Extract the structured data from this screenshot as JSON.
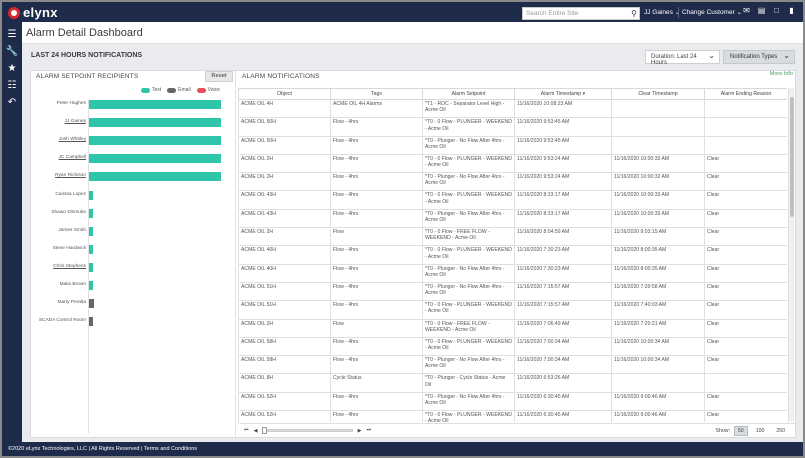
{
  "app": {
    "brand": "elynx",
    "search_placeholder": "Search Entire Site",
    "user": "JJ Gaines",
    "change_customer": "Change Customer",
    "page_title": "Alarm Detail Dashboard"
  },
  "header": {
    "section_title": "LAST 24 HOURS NOTIFICATIONS",
    "duration": "Duration: Last 24 Hours",
    "notification_types": "Notification Types"
  },
  "recipients": {
    "title": "ALARM SETPOINT RECIPIENTS",
    "reset": "Reset",
    "legend": [
      {
        "label": "Text",
        "color": "#2ec5aa"
      },
      {
        "label": "Email",
        "color": "#666666"
      },
      {
        "label": "Voice",
        "color": "#e84f5f"
      }
    ]
  },
  "chart_data": {
    "type": "bar",
    "orientation": "horizontal",
    "categories": [
      "Peter Hughes",
      "JJ Gaines",
      "Josh Whitley",
      "JC Campbell",
      "Ryan Richison",
      "Carissa Lopez",
      "Shawn Dismuke",
      "James Smith",
      "Steve Hardwick",
      "Chris Stephens",
      "Malia Brown",
      "Marty Peralta",
      "SCADA Control Room"
    ],
    "series": [
      {
        "name": "Text",
        "color": "#2ec5aa",
        "values": [
          50,
          50,
          50,
          50,
          50,
          1,
          1,
          1,
          1,
          1,
          1,
          0,
          0
        ]
      },
      {
        "name": "Email",
        "color": "#666666",
        "values": [
          0,
          0,
          0,
          0,
          0,
          0,
          0,
          0,
          0,
          0,
          0,
          2,
          1
        ]
      },
      {
        "name": "Voice",
        "color": "#e84f5f",
        "values": [
          0,
          0,
          0,
          0,
          0,
          0,
          0,
          0,
          0,
          0,
          0,
          0,
          0
        ]
      }
    ],
    "linked_labels": [
      false,
      true,
      true,
      true,
      true,
      false,
      false,
      false,
      false,
      true,
      false,
      false,
      false
    ],
    "xlim": [
      0,
      50
    ]
  },
  "notifications": {
    "title": "ALARM NOTIFICATIONS",
    "more_info": "More Info",
    "columns": [
      "Object",
      "Tags",
      "Alarm Setpoint",
      "Alarm Timestamp ▾",
      "Clear Timestamp",
      "Alarm Ending Reason"
    ],
    "rows": [
      [
        "ACME OIL 4H",
        "ACME OIL 4H Alarms",
        "*T1 - ROC - Separator Level High - Acme Oil",
        "11/16/2020 10:08:23 AM",
        "",
        ""
      ],
      [
        "ACME OIL 50H",
        "Flow - 4hrs",
        "*T0 - 0 Flow - PLUNGER - WEEKEND - Acme Oil",
        "11/16/2020 9:53:45 AM",
        "",
        ""
      ],
      [
        "ACME OIL 50H",
        "Flow - 4hrs",
        "*T0 - Plunger - No Flow After 4hrs - Acme Oil",
        "11/16/2020 9:53:45 AM",
        "",
        ""
      ],
      [
        "ACME OIL 2H",
        "Flow - 4hrs",
        "*T0 - 0 Flow - PLUNGER - WEEKEND - Acme Oil",
        "11/16/2020 9:53:24 AM",
        "11/16/2020 10:00:33 AM",
        "Clear"
      ],
      [
        "ACME OIL 2H",
        "Flow - 4hrs",
        "*T0 - Plunger - No Flow After 4hrs - Acme Oil",
        "11/16/2020 9:53:24 AM",
        "11/16/2020 10:00:32 AM",
        "Clear"
      ],
      [
        "ACME OIL 43H",
        "Flow - 4hrs",
        "*T0 - 0 Flow - PLUNGER - WEEKEND - Acme Oil",
        "11/16/2020 8:33:17 AM",
        "11/16/2020 10:00:33 AM",
        "Clear"
      ],
      [
        "ACME OIL 43H",
        "Flow - 4hrs",
        "*T0 - Plunger - No Flow After 4hrs - Acme Oil",
        "11/16/2020 8:33:17 AM",
        "11/16/2020 10:00:33 AM",
        "Clear"
      ],
      [
        "ACME OIL 2H",
        "Flow",
        "*T0 - 0 Flow - FREE FLOW - WEEKEND - Acme Oil",
        "11/16/2020 8:04:59 AM",
        "11/16/2020 9:03:15 AM",
        "Clear"
      ],
      [
        "ACME OIL 40H",
        "Flow - 4hrs",
        "*T0 - 0 Flow - PLUNGER - WEEKEND - Acme Oil",
        "11/16/2020 7:30:23 AM",
        "11/16/2020 8:00:35 AM",
        "Clear"
      ],
      [
        "ACME OIL 40H",
        "Flow - 4hrs",
        "*T0 - Plunger - No Flow After 4hrs - Acme Oil",
        "11/16/2020 7:30:23 AM",
        "11/16/2020 8:00:35 AM",
        "Clear"
      ],
      [
        "ACME OIL 51H",
        "Flow - 4hrs",
        "*T0 - Plunger - No Flow After 4hrs - Acme Oil",
        "11/16/2020 7:15:57 AM",
        "11/16/2020 7:39:58 AM",
        "Clear"
      ],
      [
        "ACME OIL 51H",
        "Flow - 4hrs",
        "*T0 - 0 Flow - PLUNGER - WEEKEND - Acme Oil",
        "11/16/2020 7:15:57 AM",
        "11/16/2020 7:40:03 AM",
        "Clear"
      ],
      [
        "ACME OIL 2H",
        "Flow",
        "*T0 - 0 Flow - FREE FLOW - WEEKEND - Acme Oil",
        "11/16/2020 7:06:49 AM",
        "11/16/2020 7:20:21 AM",
        "Clear"
      ],
      [
        "ACME OIL 58H",
        "Flow - 4hrs",
        "*T0 - 0 Flow - PLUNGER - WEEKEND - Acme Oil",
        "11/16/2020 7:00:34 AM",
        "11/16/2020 10:00:34 AM",
        "Clear"
      ],
      [
        "ACME OIL 58H",
        "Flow - 4hrs",
        "*T0 - Plunger - No Flow After 4hrs - Acme Oil",
        "11/16/2020 7:00:34 AM",
        "11/16/2020 10:00:34 AM",
        "Clear"
      ],
      [
        "ACME OIL 8H",
        "Cycle Status",
        "*T0 - Plunger - Cycle Status - Acme Oil",
        "11/16/2020 6:53:26 AM",
        "",
        ""
      ],
      [
        "ACME OIL 52H",
        "Flow - 4hrs",
        "*T0 - Plunger - No Flow After 4hrs - Acme Oil",
        "11/16/2020 6:30:45 AM",
        "11/16/2020 9:00:46 AM",
        "Clear"
      ],
      [
        "ACME OIL 52H",
        "Flow - 4hrs",
        "*T0 - 0 Flow - PLUNGER - WEEKEND - Acme Oil",
        "11/16/2020 6:30:45 AM",
        "11/16/2020 9:00:46 AM",
        "Clear"
      ]
    ],
    "show_label": "Show:",
    "page_sizes": [
      "50",
      "100",
      "250"
    ],
    "active_page_size": "50"
  },
  "footer": {
    "text": "©2020 eLynx Technologies, LLC | All Rights Reserved | Terms and Conditions"
  }
}
